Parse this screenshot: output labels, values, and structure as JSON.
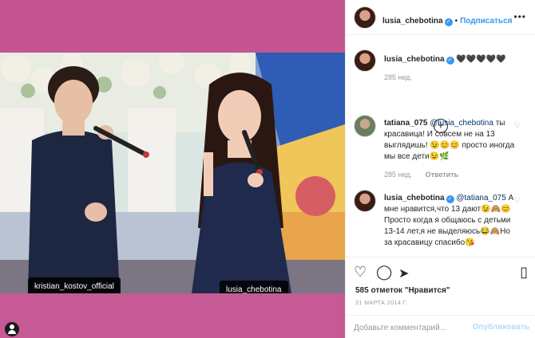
{
  "post": {
    "tags": {
      "kristian": "kristian_kostov_official",
      "lusia": "lusia_chebotina"
    }
  },
  "header": {
    "username": "lusia_chebotina",
    "separator": "•",
    "follow_label": "Подписаться",
    "more_icon": "more-options-icon"
  },
  "caption": {
    "username": "lusia_chebotina",
    "text": "🖤🖤🖤🖤🖤",
    "time": "285 нед."
  },
  "comments": [
    {
      "username": "tatiana_075",
      "mention": "@lusia_chebotina",
      "text": " ты красавица! И совсем не на 13 выглядишь! 😉😊😊 просто иногда мы все дети😉🌿",
      "time": "285 нед.",
      "reply_label": "Ответить"
    },
    {
      "username": "lusia_chebotina",
      "mention": "@tatiana_075",
      "text": " А мне нравится,что 13 дают😉🙈😊Просто когда я общаюсь с детьми 13-14 лет,я не выделяюсь😂🙈Но за красавицу спасибо😘"
    }
  ],
  "actions": {
    "likes_text": "585 отметок \"Нравится\"",
    "date": "31 МАРТА 2014 Г.",
    "comment_placeholder": "Добавьте комментарий...",
    "post_label": "Опубликовать"
  },
  "colors": {
    "accent": "#3897f0",
    "background_pink": "#c6538f"
  }
}
